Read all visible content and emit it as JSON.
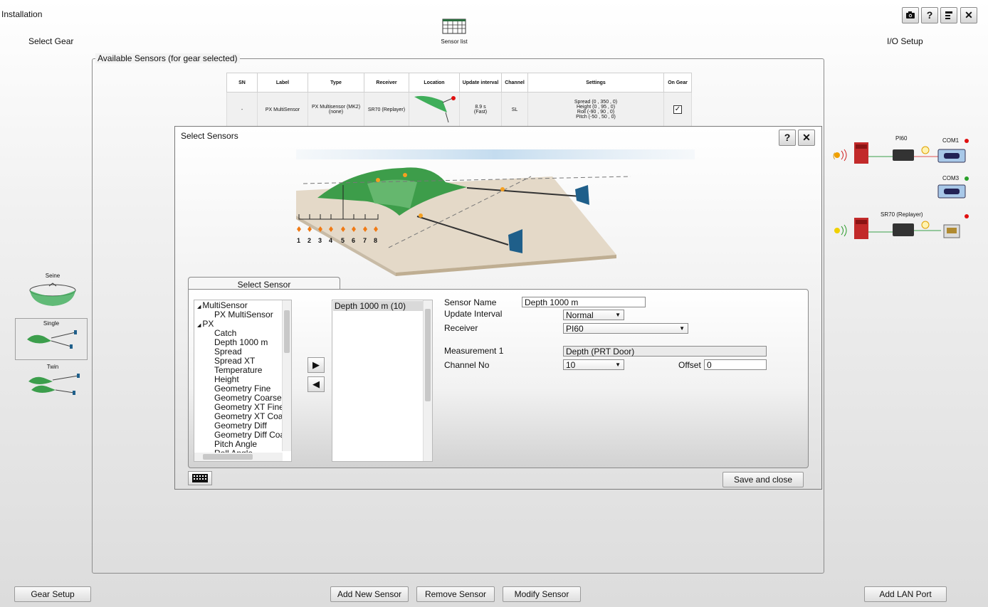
{
  "window": {
    "title": "Installation"
  },
  "left_panel": {
    "title": "Select Gear",
    "gears": [
      {
        "label": "Seine"
      },
      {
        "label": "Single"
      },
      {
        "label": "Twin"
      }
    ],
    "selected": "Single"
  },
  "center": {
    "sensor_list_label": "Sensor list",
    "group_label": "Available Sensors (for gear selected)",
    "table": {
      "headers": [
        "SN",
        "Label",
        "Type",
        "Receiver",
        "Location",
        "Update interval",
        "Channel",
        "Settings",
        "On Gear"
      ],
      "rows": [
        {
          "sn": "-",
          "label": "PX MultiSensor",
          "type": "PX Multisensor (MK2)\n(none)",
          "receiver": "SR70 (Replayer)",
          "update": "8.9 s\n(Fast)",
          "channel": "SL",
          "settings": [
            "Spread (0 , 350 , 0)",
            "Height (0 , 95 , 0)",
            "Roll (-90 , 90 , 0)",
            "Pitch (-50 , 50 , 0)"
          ],
          "on_gear": true
        }
      ]
    }
  },
  "right_panel": {
    "title": "I/O Setup",
    "devices": [
      {
        "name": "PI60",
        "port": "COM1",
        "port_status_color": "#e01010"
      },
      {
        "name": "",
        "port": "COM3",
        "port_status_color": "#2aa02a"
      },
      {
        "name": "SR70 (Replayer)",
        "port": "",
        "port_status_color": "#e01010"
      }
    ]
  },
  "dialog": {
    "title": "Select Sensors",
    "help_label": "?",
    "close_label": "✕",
    "trawl_positions": [
      "1",
      "2",
      "3",
      "4",
      "5",
      "6",
      "7",
      "8"
    ],
    "tab_label": "Select Sensor",
    "tree": [
      {
        "label": "MultiSensor",
        "level": 0,
        "expanded": true
      },
      {
        "label": "PX MultiSensor",
        "level": 1
      },
      {
        "label": "PX",
        "level": 0,
        "expanded": true
      },
      {
        "label": "Catch",
        "level": 1
      },
      {
        "label": "Depth 1000 m",
        "level": 1
      },
      {
        "label": "Spread",
        "level": 1
      },
      {
        "label": "Spread XT",
        "level": 1
      },
      {
        "label": "Temperature",
        "level": 1
      },
      {
        "label": "Height",
        "level": 1
      },
      {
        "label": "Geometry Fine",
        "level": 1
      },
      {
        "label": "Geometry Coarse",
        "level": 1
      },
      {
        "label": "Geometry XT Fine",
        "level": 1
      },
      {
        "label": "Geometry XT Coarse",
        "level": 1
      },
      {
        "label": "Geometry Diff",
        "level": 1
      },
      {
        "label": "Geometry Diff Coarse",
        "level": 1
      },
      {
        "label": "Pitch Angle",
        "level": 1
      },
      {
        "label": "Roll Angle",
        "level": 1
      }
    ],
    "selected_list": [
      "Depth 1000 m (10)"
    ],
    "form": {
      "sensor_name_label": "Sensor Name",
      "sensor_name_value": "Depth 1000 m",
      "update_interval_label": "Update Interval",
      "update_interval_value": "Normal",
      "receiver_label": "Receiver",
      "receiver_value": "PI60",
      "measurement_label": "Measurement 1",
      "measurement_value": "Depth (PRT Door)",
      "channel_label": "Channel No",
      "channel_value": "10",
      "offset_label": "Offset",
      "offset_value": "0"
    },
    "save_label": "Save and close"
  },
  "bottom": {
    "gear_setup": "Gear Setup",
    "add_new_sensor": "Add New Sensor",
    "remove_sensor": "Remove Sensor",
    "modify_sensor": "Modify Sensor",
    "add_lan_port": "Add LAN Port"
  },
  "toolbar": {
    "help": "?"
  }
}
